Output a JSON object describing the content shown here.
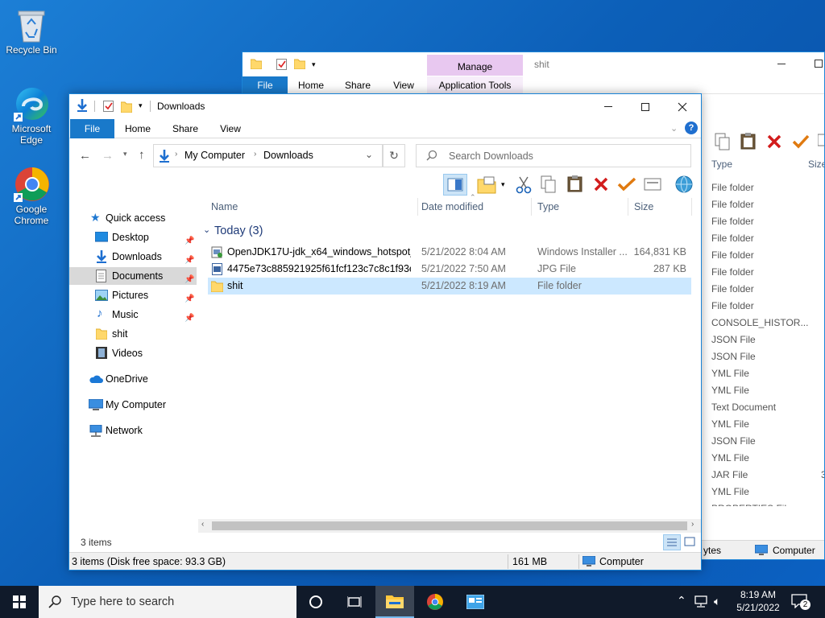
{
  "desktop": {
    "icons": [
      {
        "label1": "Recycle Bin",
        "label2": ""
      },
      {
        "label1": "Microsoft",
        "label2": "Edge"
      },
      {
        "label1": "Google",
        "label2": "Chrome"
      }
    ]
  },
  "back_window": {
    "title": "shit",
    "manage_tab": "Manage",
    "tabs": [
      "File",
      "Home",
      "Share",
      "View",
      "Application Tools"
    ],
    "col_type": "Type",
    "col_size": "Size",
    "types": [
      "File folder",
      "File folder",
      "File folder",
      "File folder",
      "File folder",
      "File folder",
      "File folder",
      "File folder",
      "CONSOLE_HISTOR...",
      "JSON File",
      "JSON File",
      "YML File",
      "YML File",
      "Text Document",
      "YML File",
      "JSON File",
      "YML File",
      "JAR File",
      "YML File",
      "PROPERTIES Fil"
    ],
    "jar_size_partial": "3",
    "status_bytes": "ytes",
    "status_computer": "Computer"
  },
  "window": {
    "title": "Downloads",
    "ribbon_tabs": [
      "File",
      "Home",
      "Share",
      "View"
    ],
    "breadcrumb": [
      "My Computer",
      "Downloads"
    ],
    "search_placeholder": "Search Downloads",
    "columns": {
      "name": "Name",
      "date": "Date modified",
      "type": "Type",
      "size": "Size"
    },
    "group_label": "Today (3)",
    "files": [
      {
        "name": "OpenJDK17U-jdk_x64_windows_hotspot_...",
        "date": "5/21/2022 8:04 AM",
        "type": "Windows Installer ...",
        "size": "164,831 KB",
        "icon": "installer-icon"
      },
      {
        "name": "4475e73c885921925f61fcf123c7c8c1f93e1...",
        "date": "5/21/2022 7:50 AM",
        "type": "JPG File",
        "size": "287 KB",
        "icon": "image-file-icon"
      },
      {
        "name": "shit",
        "date": "5/21/2022 8:19 AM",
        "type": "File folder",
        "size": "",
        "icon": "folder-icon"
      }
    ],
    "nav": {
      "quick_access": "Quick access",
      "items": [
        "Desktop",
        "Downloads",
        "Documents",
        "Pictures",
        "Music",
        "shit",
        "Videos"
      ],
      "onedrive": "OneDrive",
      "my_computer": "My Computer",
      "network": "Network"
    },
    "item_count": "3 items",
    "status": {
      "items": "3 items (Disk free space: 93.3 GB)",
      "size": "161 MB",
      "location": "Computer"
    }
  },
  "taskbar": {
    "search_placeholder": "Type here to search",
    "time": "8:19 AM",
    "date": "5/21/2022",
    "notification_count": "2"
  },
  "colors": {
    "accent": "#0078d7",
    "selection": "#cce8ff",
    "taskbar": "#101a2a",
    "manage_tab": "#e8c8f0"
  }
}
